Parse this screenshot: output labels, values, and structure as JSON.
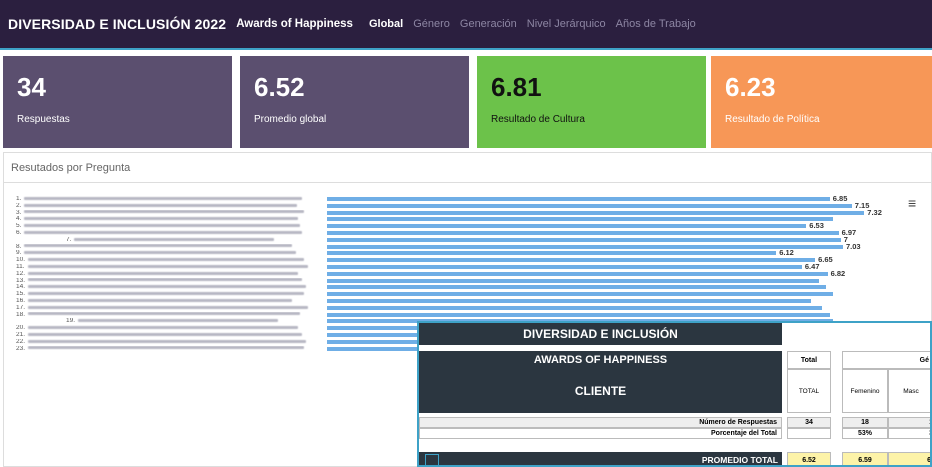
{
  "header": {
    "title": "DIVERSIDAD E INCLUSIÓN 2022",
    "subtitle": "Awards of Happiness",
    "tabs": [
      "Global",
      "Género",
      "Generación",
      "Nivel Jerárquico",
      "Años de Trabajo"
    ],
    "active_tab": "Global"
  },
  "cards": [
    {
      "value": "34",
      "label": "Respuestas",
      "color": "#5b4f6f"
    },
    {
      "value": "6.52",
      "label": "Promedio global",
      "color": "#5b4f6f"
    },
    {
      "value": "6.81",
      "label": "Resultado de Cultura",
      "color": "#6cc24a"
    },
    {
      "value": "6.23",
      "label": "Resultado de Política",
      "color": "#f79757"
    }
  ],
  "section_title": "Resutados por Pregunta",
  "question_numbers": [
    "1.",
    "2.",
    "3.",
    "4.",
    "5.",
    "6.",
    "7.",
    "8.",
    "9.",
    "10.",
    "11.",
    "12.",
    "13.",
    "14.",
    "15.",
    "16.",
    "17.",
    "18.",
    "19.",
    "20.",
    "21.",
    "22.",
    "23."
  ],
  "chart_data": {
    "type": "bar",
    "orientation": "horizontal",
    "bar_color": "#6faee6",
    "values_visible": [
      6.85,
      7.15,
      7.32,
      null,
      6.53,
      6.97,
      7,
      7.03,
      6.12,
      6.65,
      6.47,
      6.82
    ],
    "categories": [
      "1.",
      "2.",
      "3.",
      "4.",
      "5.",
      "6.",
      "7.",
      "8.",
      "9.",
      "10.",
      "11.",
      "12.",
      "13.",
      "14.",
      "15.",
      "16.",
      "17.",
      "18.",
      "19.",
      "20.",
      "21.",
      "22.",
      "23."
    ]
  },
  "popup": {
    "title1": "DIVERSIDAD E INCLUSIÓN",
    "title2": "AWARDS OF HAPPINESS",
    "title3": "CLIENTE",
    "col_total": "Total",
    "col_total_sub": "TOTAL",
    "col_genero": "Gé",
    "col_fem": "Femenino",
    "col_masc": "Masc",
    "row1_label": "Número de Respuestas",
    "row1_total": "34",
    "row1_fem": "18",
    "row1_masc": "1",
    "row2_label": "Porcentaje del Total",
    "row2_fem": "53%",
    "row2_masc": "3",
    "row3_label": "PROMEDIO TOTAL",
    "row3_total": "6.52",
    "row3_fem": "6.59",
    "row3_masc": "6."
  }
}
